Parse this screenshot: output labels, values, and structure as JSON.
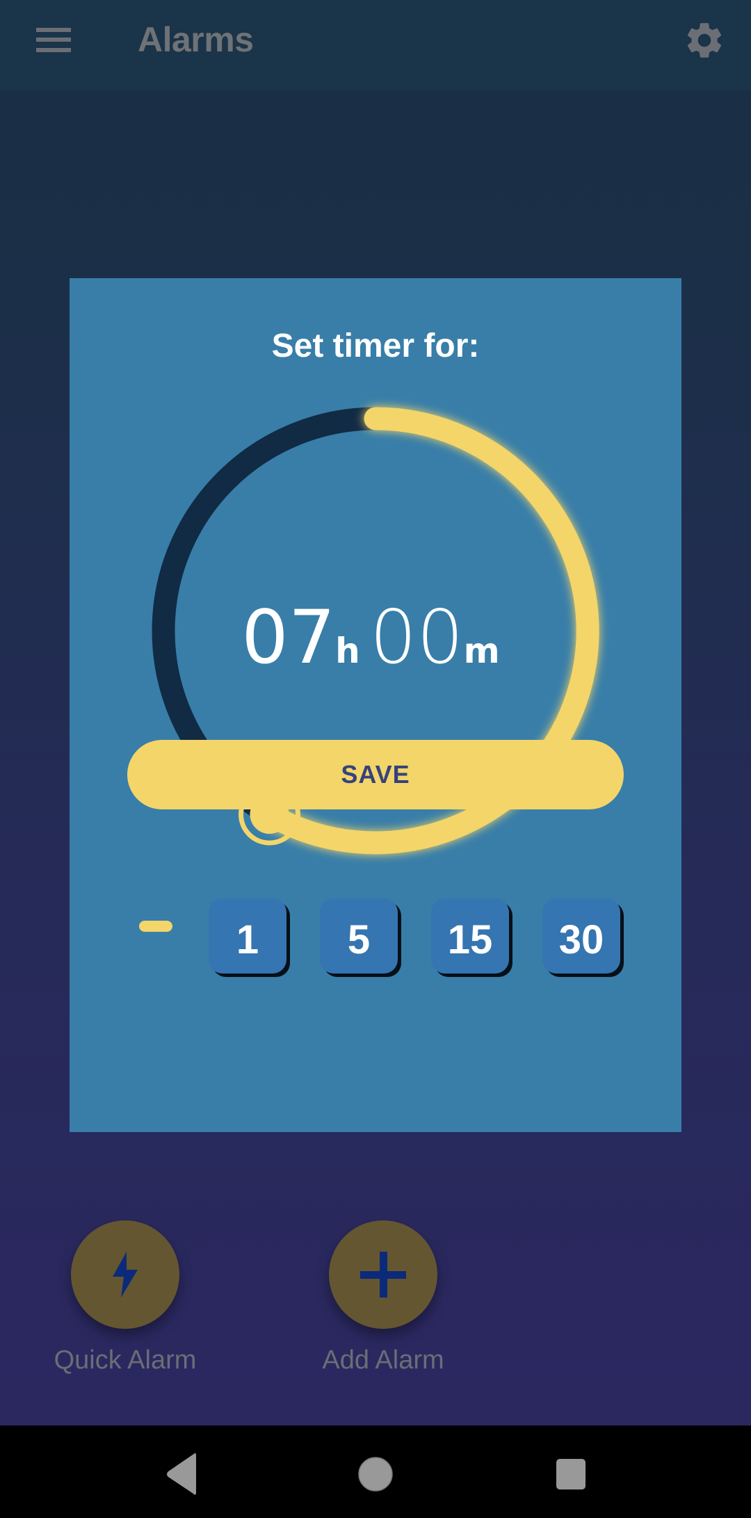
{
  "app_bar": {
    "title": "Alarms",
    "menu_icon": "hamburger-menu-icon",
    "settings_icon": "gear-icon"
  },
  "dialog": {
    "title": "Set timer for:",
    "time": {
      "hours": "07",
      "hours_unit": "h",
      "minutes": "00",
      "minutes_unit": "m"
    },
    "dial": {
      "value_hours": 7,
      "max_hours": 12,
      "fraction": 0.5833
    },
    "decrement_icon": "minus-icon",
    "increments": [
      "1",
      "5",
      "15",
      "30"
    ],
    "save_label": "SAVE"
  },
  "actions": [
    {
      "label": "Quick Alarm",
      "icon": "lightning-bolt-icon"
    },
    {
      "label": "Add Alarm",
      "icon": "plus-icon"
    }
  ],
  "nav": {
    "back_icon": "back-triangle-icon",
    "home_icon": "home-circle-icon",
    "recents_icon": "recents-square-icon"
  },
  "colors": {
    "dialog_bg": "#387ea9",
    "accent_yellow": "#f3d56a",
    "track_dark": "#112b45",
    "increment_button": "#3575b1",
    "save_text": "#37427b"
  }
}
